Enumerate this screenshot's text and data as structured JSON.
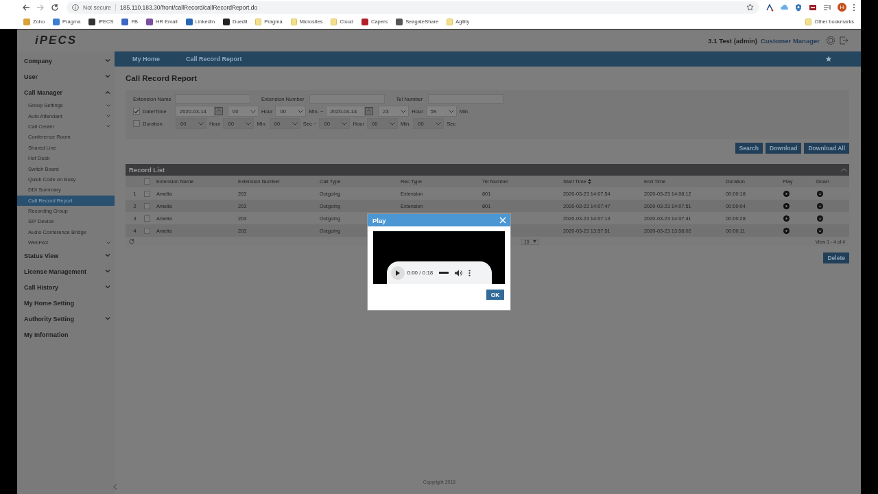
{
  "browser": {
    "security": "Not secure",
    "url": "185.110.183.30/front/callRecord/callRecordReport.do",
    "profile": "H",
    "bookmarks": [
      {
        "label": "Zoho",
        "kind": "site",
        "color": "#d9a23a"
      },
      {
        "label": "Pragma",
        "kind": "site",
        "color": "#3b7fd1"
      },
      {
        "label": "iPECS",
        "kind": "site",
        "color": "#333333"
      },
      {
        "label": "FB",
        "kind": "site",
        "color": "#3b66c4"
      },
      {
        "label": "HR Email",
        "kind": "site",
        "color": "#7a4fa0"
      },
      {
        "label": "LinkedIn",
        "kind": "site",
        "color": "#2867b2"
      },
      {
        "label": "Duedil",
        "kind": "site",
        "color": "#222222"
      },
      {
        "label": "Pragma",
        "kind": "folder"
      },
      {
        "label": "Microsites",
        "kind": "folder"
      },
      {
        "label": "Cloud",
        "kind": "folder"
      },
      {
        "label": "Capers",
        "kind": "site",
        "color": "#b3202a"
      },
      {
        "label": "SeagateShare",
        "kind": "site",
        "color": "#555555"
      },
      {
        "label": "Agility",
        "kind": "folder"
      }
    ],
    "other_bookmarks": "Other bookmarks"
  },
  "header": {
    "logo": "iPECS",
    "user": "3.1 Test (admin)",
    "role": "Customer Manager"
  },
  "sidebar": {
    "items": [
      {
        "label": "Company",
        "kind": "group",
        "expanded": false,
        "selected": false
      },
      {
        "label": "User",
        "kind": "group",
        "expanded": false,
        "selected": false
      },
      {
        "label": "Call Manager",
        "kind": "group",
        "expanded": true,
        "selected": false,
        "children": [
          {
            "label": "Group Settings",
            "kind": "group",
            "expanded": false,
            "selected": false
          },
          {
            "label": "Auto Attendant",
            "kind": "group",
            "expanded": false,
            "selected": false
          },
          {
            "label": "Call Center",
            "kind": "group",
            "expanded": false,
            "selected": false
          },
          {
            "label": "Conference Room",
            "kind": "link",
            "selected": false
          },
          {
            "label": "Shared Line",
            "kind": "link",
            "selected": false
          },
          {
            "label": "Hot Desk",
            "kind": "link",
            "selected": false
          },
          {
            "label": "Switch Board",
            "kind": "link",
            "selected": false
          },
          {
            "label": "Quick Code on Busy",
            "kind": "link",
            "selected": false
          },
          {
            "label": "DDI Summary",
            "kind": "link",
            "selected": false
          },
          {
            "label": "Call Record Report",
            "kind": "link",
            "selected": true
          },
          {
            "label": "Recording Group",
            "kind": "link",
            "selected": false
          },
          {
            "label": "SIP Device",
            "kind": "link",
            "selected": false
          },
          {
            "label": "Audio Conference Bridge",
            "kind": "link",
            "selected": false
          },
          {
            "label": "WebFAX",
            "kind": "group",
            "expanded": false,
            "selected": false
          }
        ]
      },
      {
        "label": "Status View",
        "kind": "group",
        "expanded": false,
        "selected": false
      },
      {
        "label": "License Management",
        "kind": "group",
        "expanded": false,
        "selected": false
      },
      {
        "label": "Call History",
        "kind": "group",
        "expanded": false,
        "selected": false
      },
      {
        "label": "My Home Setting",
        "kind": "link",
        "selected": false
      },
      {
        "label": "Authority Setting",
        "kind": "group",
        "expanded": false,
        "selected": false
      },
      {
        "label": "My Information",
        "kind": "link",
        "selected": false
      }
    ]
  },
  "breadcrumbs": [
    "My Home",
    "Call Record Report"
  ],
  "page_title": "Call Record Report",
  "filters": {
    "fields": [
      {
        "label": "Extension Name"
      },
      {
        "label": "Extension Number"
      },
      {
        "label": "Tel Number"
      }
    ],
    "ranges": [
      {
        "label": "Date/Time",
        "checked": true,
        "parts": [
          {
            "kind": "date",
            "value": "2020-03-14"
          },
          {
            "kind": "select",
            "value": "00"
          },
          {
            "kind": "unit",
            "text": "Hour"
          },
          {
            "kind": "select",
            "value": "00"
          },
          {
            "kind": "unit",
            "text": "Min. ~"
          },
          {
            "kind": "date",
            "value": "2020-04-14"
          },
          {
            "kind": "select",
            "value": "23"
          },
          {
            "kind": "unit",
            "text": "Hour"
          },
          {
            "kind": "select",
            "value": "59"
          },
          {
            "kind": "unit",
            "text": "Min."
          }
        ]
      },
      {
        "label": "Duration",
        "checked": false,
        "parts": [
          {
            "kind": "select",
            "value": "00"
          },
          {
            "kind": "unit",
            "text": "Hour"
          },
          {
            "kind": "select",
            "value": "00"
          },
          {
            "kind": "unit",
            "text": "Min."
          },
          {
            "kind": "select",
            "value": "00"
          },
          {
            "kind": "unit",
            "text": "Sec ~"
          },
          {
            "kind": "select",
            "value": "00"
          },
          {
            "kind": "unit",
            "text": "Hour"
          },
          {
            "kind": "select",
            "value": "00"
          },
          {
            "kind": "unit",
            "text": "Min."
          },
          {
            "kind": "select",
            "value": "00"
          },
          {
            "kind": "unit",
            "text": "Sec"
          }
        ]
      }
    ]
  },
  "buttons": [
    "Search",
    "Download",
    "Download All"
  ],
  "record_list": {
    "title": "Record List",
    "columns": [
      {
        "label": "Extension Name",
        "sorted": false
      },
      {
        "label": "Extension Number",
        "sorted": false
      },
      {
        "label": "Call Type",
        "sorted": false
      },
      {
        "label": "Rec Type",
        "sorted": false
      },
      {
        "label": "Tel Number",
        "sorted": false
      },
      {
        "label": "Start Time",
        "sorted": true
      },
      {
        "label": "End Time",
        "sorted": false
      },
      {
        "label": "Duration",
        "sorted": false
      },
      {
        "label": "Play",
        "sorted": false
      },
      {
        "label": "Down",
        "sorted": false
      }
    ],
    "rows": [
      {
        "index": "1",
        "selected": false,
        "extension_name": "Amelia",
        "extension_number": "203",
        "call_type": "Outgoing",
        "rec_type": "Extension",
        "tel_number": "801",
        "start_time": "2020-03-23 14:07:54",
        "end_time": "2020-03-23 14:08:12",
        "duration": "00:00:18"
      },
      {
        "index": "2",
        "selected": false,
        "extension_name": "Amelia",
        "extension_number": "203",
        "call_type": "Outgoing",
        "rec_type": "Extension",
        "tel_number": "801",
        "start_time": "2020-03-23 14:07:47",
        "end_time": "2020-03-23 14:07:51",
        "duration": "00:00:04"
      },
      {
        "index": "3",
        "selected": false,
        "extension_name": "Amelia",
        "extension_number": "203",
        "call_type": "Outgoing",
        "start_time": "2020-03-23 14:07:13",
        "end_time": "2020-03-23 14:07:41",
        "duration": "00:00:28"
      },
      {
        "index": "4",
        "selected": false,
        "extension_name": "Amelia",
        "extension_number": "203",
        "call_type": "Outgoing",
        "start_time": "2020-03-23 13:57:51",
        "end_time": "2020-03-23 13:58:02",
        "duration": "00:00:11"
      }
    ],
    "all_selected": false,
    "page_size": "10",
    "summary": "View 1 - 4 of 4"
  },
  "delete_button": "Delete",
  "footer": "Copyright 2015",
  "dialog": {
    "title": "Play",
    "time": "0:00 / 0:18",
    "ok": "OK"
  }
}
